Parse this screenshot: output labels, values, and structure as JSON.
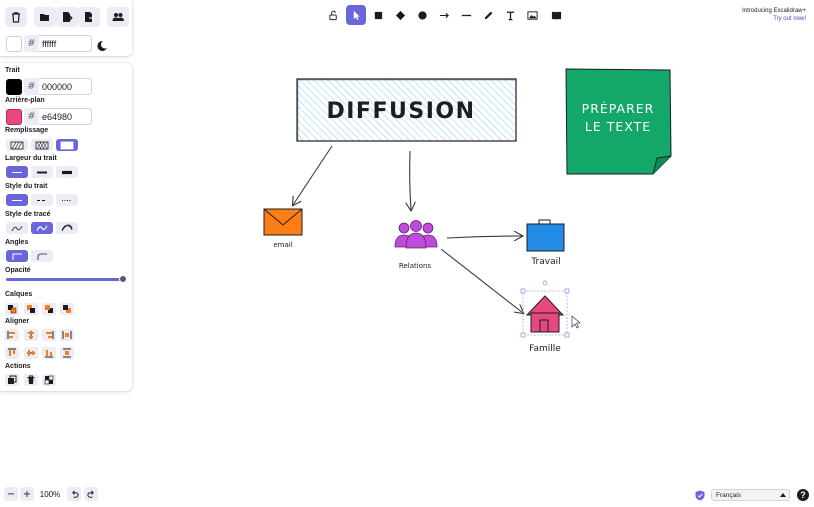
{
  "canvas": {
    "title_box_text": "DIFFUSION",
    "sticky_line1": "PRÉPARER",
    "sticky_line2": "LE TEXTE",
    "labels": {
      "email": "email",
      "relations": "Relations",
      "travail": "Travail",
      "famille": "Famille"
    },
    "colors": {
      "sticky": "#13a76a",
      "envelope": "#fd7e14",
      "people": "#be4bdb",
      "briefcase": "#228be6",
      "house": "#e64980",
      "hatch": "#a5d8ff"
    }
  },
  "menu": {
    "icons": [
      "trash-icon",
      "folder-open-icon",
      "export-icon",
      "share-icon",
      "users-icon"
    ]
  },
  "background": {
    "hash": "#",
    "value": "ffffff"
  },
  "props": {
    "stroke_label": "Trait",
    "stroke_value": "000000",
    "background_label": "Arrière-plan",
    "background_value": "e64980",
    "hash": "#",
    "fill_label": "Remplissage",
    "stroke_width_label": "Largeur du trait",
    "stroke_style_label": "Style du trait",
    "sloppiness_label": "Style de tracé",
    "edges_label": "Angles",
    "opacity_label": "Opacité",
    "opacity_value": 100,
    "layers_label": "Calques",
    "align_label": "Aligner",
    "actions_label": "Actions"
  },
  "toolbar": {
    "accent": "#6965db",
    "selected_tool": "selection"
  },
  "promo": {
    "title": "Introducing Excalidraw+",
    "link": "Try out now!"
  },
  "footer": {
    "zoom_out": "−",
    "zoom_in": "+",
    "zoom_value": "100%",
    "language": "Français",
    "help": "?"
  }
}
